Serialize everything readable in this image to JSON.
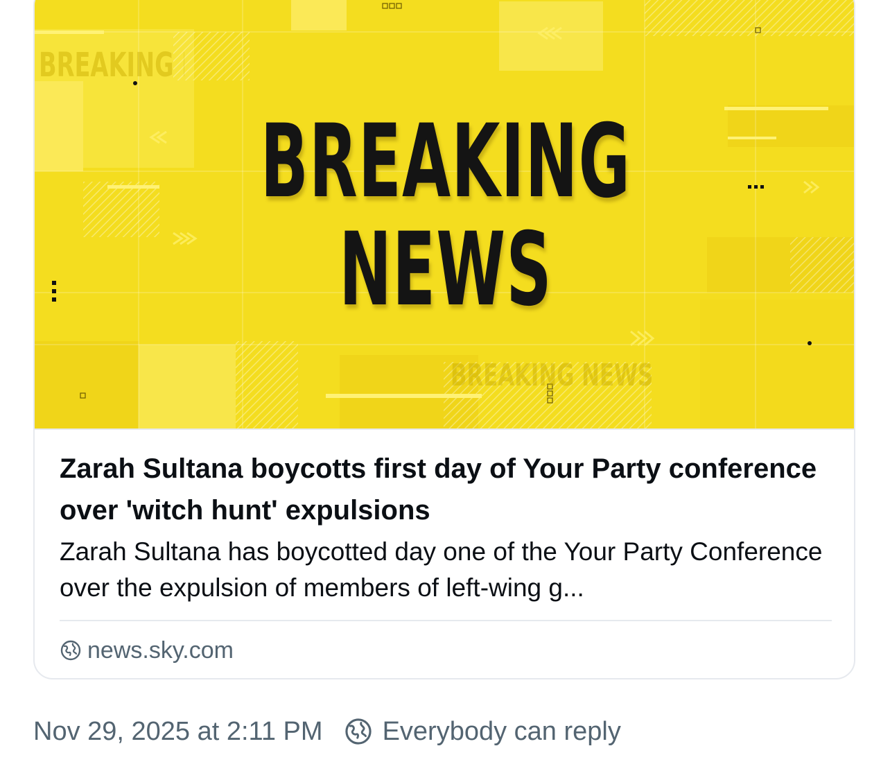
{
  "link_card": {
    "image": {
      "line1": "BREAKING",
      "line2": "NEWS",
      "watermark_top": "BREAKING NEWS",
      "watermark_bottom": "BREAKING NEWS",
      "background_color": "#f4dd1f"
    },
    "headline": "Zarah Sultana boycotts first day of Your Party conference over 'witch hunt' expulsions",
    "description": "Zarah Sultana has boycotted day one of the Your Party Conference over the expulsion of members of left-wing g...",
    "source_icon": "globe-icon",
    "source": "news.sky.com"
  },
  "post_meta": {
    "timestamp": "Nov 29, 2025 at 2:11 PM",
    "reply_icon": "globe-icon",
    "reply_setting": "Everybody can reply"
  }
}
